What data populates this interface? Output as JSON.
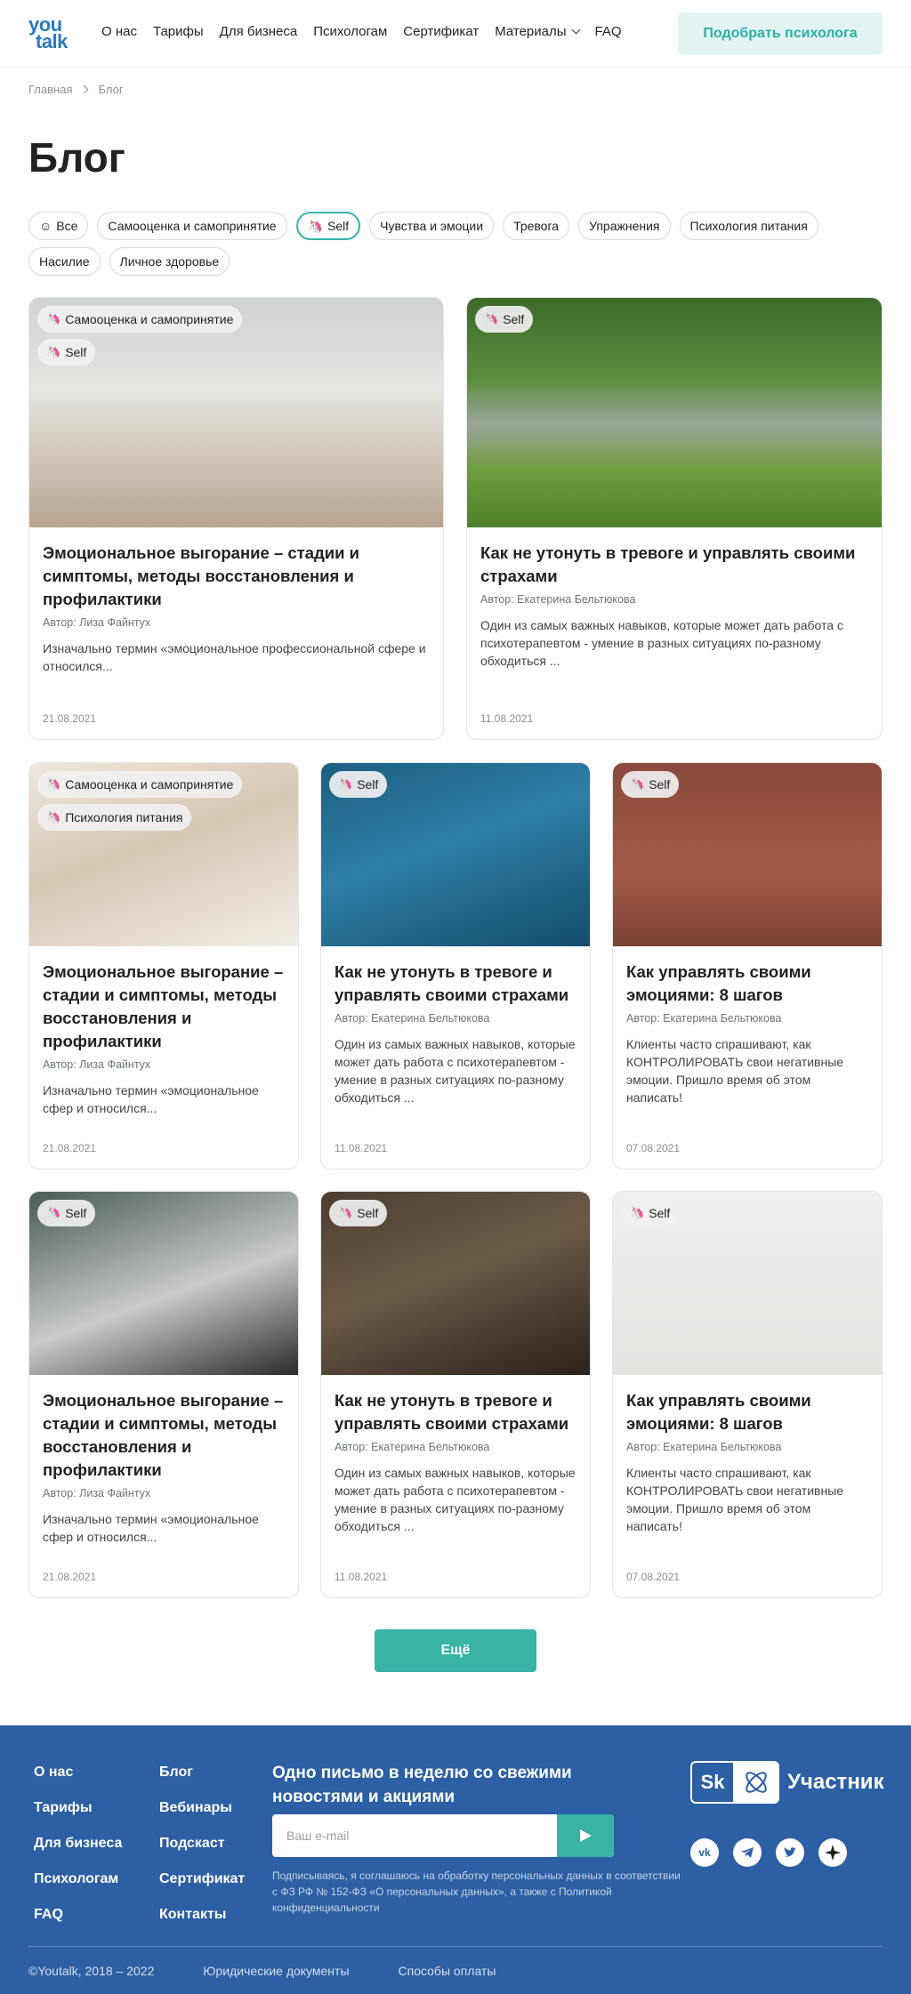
{
  "header": {
    "logo_line1": "you",
    "logo_line2": "talk",
    "nav": [
      "О нас",
      "Тарифы",
      "Для бизнеса",
      "Психологам",
      "Сертификат",
      "Материалы",
      "FAQ"
    ],
    "cta": "Подобрать психолога"
  },
  "breadcrumb": {
    "home": "Главная",
    "current": "Блог"
  },
  "page_title": "Блог",
  "filters": [
    {
      "label": "Все",
      "icon": "☺"
    },
    {
      "label": "Самооценка и самопринятие",
      "icon": ""
    },
    {
      "label": "Self",
      "icon": "🦄",
      "active": true
    },
    {
      "label": "Чувства и эмоции",
      "icon": ""
    },
    {
      "label": "Тревога",
      "icon": ""
    },
    {
      "label": "Упражнения",
      "icon": ""
    },
    {
      "label": "Психология питания",
      "icon": ""
    },
    {
      "label": "Насилие",
      "icon": ""
    },
    {
      "label": "Личное здоровье",
      "icon": ""
    }
  ],
  "tag_icon": "🦄",
  "cards": [
    {
      "tags": [
        "Самооценка и самопринятие",
        "Self"
      ],
      "title": "Эмоциональное выгорание – стадии и симптомы, методы восстановления и профилактики",
      "author": "Автор: Лиза Файнтух",
      "excerpt": "Изначально термин «эмоциональное профессиональной сфере и относился...",
      "date": "21.08.2021",
      "image": "eggs-photo"
    },
    {
      "tags": [
        "Self"
      ],
      "title": "Как не утонуть в тревоге и управлять своими страхами",
      "author": "Автор: Екатерина Бельтюкова",
      "excerpt": "Один из самых важных навыков, которые может дать работа с психотерапевтом - умение в разных ситуациях по-разному обходиться ...",
      "date": "11.08.2021",
      "image": "running-photo"
    },
    {
      "tags": [
        "Самооценка и самопринятие",
        "Психология питания"
      ],
      "title": "Эмоциональное выгорание – стадии и симптомы, методы восстановления и профилактики",
      "author": "Автор: Лиза Файнтух",
      "excerpt": "Изначально термин «эмоциональное сфер и относился...",
      "date": "21.08.2021",
      "image": "bed-photo"
    },
    {
      "tags": [
        "Self"
      ],
      "title": "Как не утонуть в тревоге и управлять своими страхами",
      "author": "Автор: Екатерина Бельтюкова",
      "excerpt": "Один из самых важных навыков, которые может дать работа с психотерапевтом - умение в разных ситуациях по-разному обходиться ...",
      "date": "11.08.2021",
      "image": "water-photo"
    },
    {
      "tags": [
        "Self"
      ],
      "title": "Как управлять своими эмоциями: 8 шагов",
      "author": "Автор: Екатерина Бельтюкова",
      "excerpt": "Клиенты часто спрашивают, как КОНТРОЛИРОВАТЬ свои негативные эмоции. Пришло время об этом написать!",
      "date": "07.08.2021",
      "image": "angry-face-photo"
    },
    {
      "tags": [
        "Self"
      ],
      "title": "Эмоциональное выгорание – стадии и симптомы, методы восстановления и профилактики",
      "author": "Автор: Лиза Файнтух",
      "excerpt": "Изначально термин «эмоциональное сфер и относился...",
      "date": "21.08.2021",
      "image": "woman-laptop-photo"
    },
    {
      "tags": [
        "Self"
      ],
      "title": "Как не утонуть в тревоге и управлять своими страхами",
      "author": "Автор: Екатерина Бельтюкова",
      "excerpt": "Один из самых важных навыков, которые может дать работа с психотерапевтом - умение в разных ситуациях по-разному обходиться ...",
      "date": "11.08.2021",
      "image": "videocall-photo"
    },
    {
      "tags": [
        "Self"
      ],
      "title": "Как управлять своими эмоциями: 8 шагов",
      "author": "Автор: Екатерина Бельтюкова",
      "excerpt": "Клиенты часто спрашивают, как КОНТРОЛИРОВАТЬ свои негативные эмоции. Пришло время об этом написать!",
      "date": "07.08.2021",
      "image": "people-walking-photo"
    }
  ],
  "more_button": "Ещё",
  "footer": {
    "col1": [
      "О нас",
      "Тарифы",
      "Для бизнеса",
      "Психологам",
      "FAQ"
    ],
    "col2": [
      "Блог",
      "Вебинары",
      "Подскаст",
      "Сертификат",
      "Контакты"
    ],
    "newsletter_title": "Одно письмо в неделю со свежими новостями и акциями",
    "email_placeholder": "Ваш e-mail",
    "consent": "Подписываясь, я соглашаюсь на обработку персональных данных в соответствии с ФЗ РФ № 152-ФЗ «О персональных данных», а также с Политикой конфиденциальности",
    "sk_label": "Участник",
    "socials": [
      "vk-icon",
      "telegram-icon",
      "twitter-icon",
      "star-icon"
    ],
    "copyright": "©Youtalk, 2018 – 2022",
    "legal": "Юридические документы",
    "payment": "Способы оплаты"
  },
  "colors": {
    "accent": "#38b3a6",
    "footer_bg": "#2c5fa3",
    "logo": "#2a7bbf"
  }
}
